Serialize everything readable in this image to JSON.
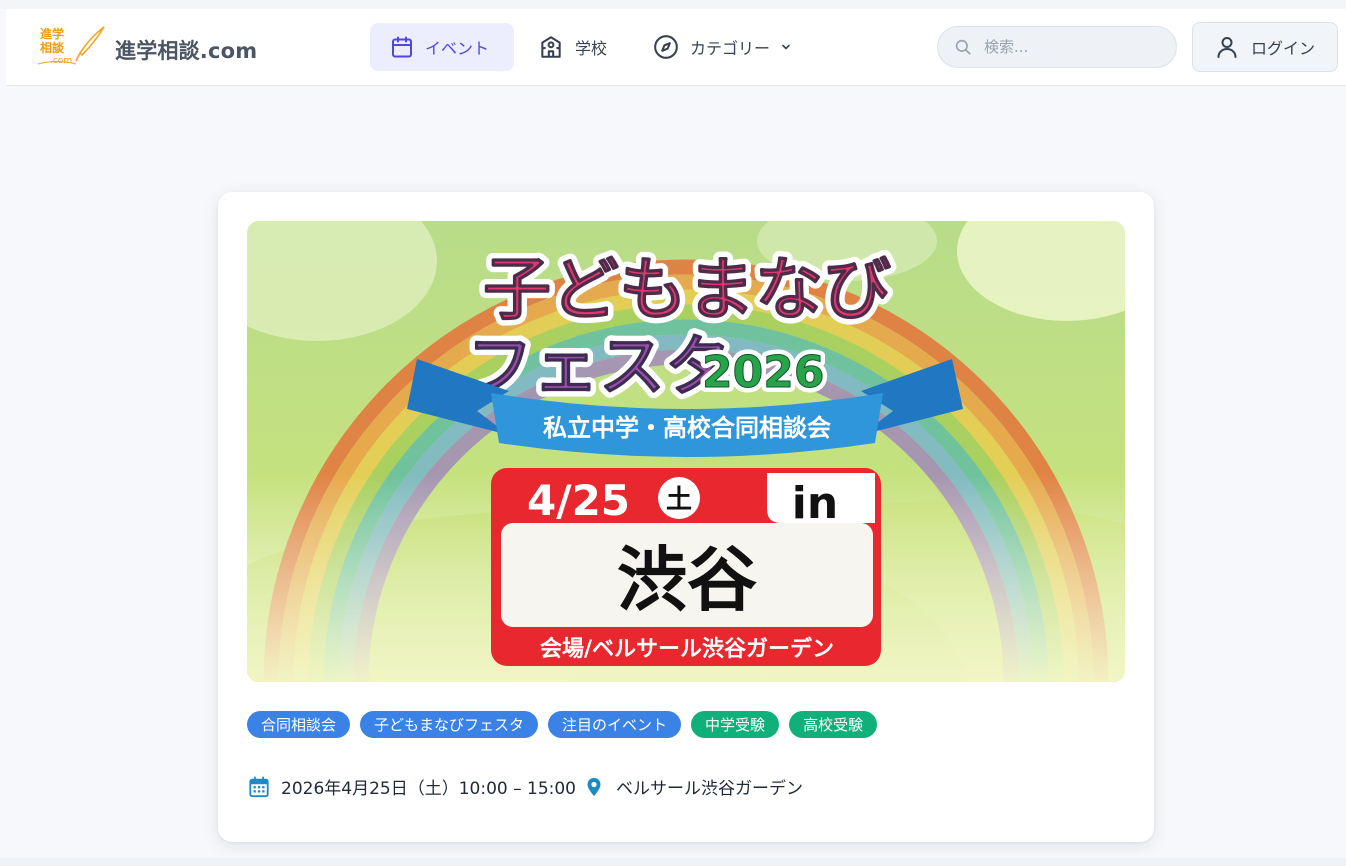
{
  "brand": {
    "site_name": "進学相談.com",
    "logo_line1": "進学",
    "logo_line2": "相談",
    "logo_line3": ".com"
  },
  "nav": {
    "events": "イベント",
    "schools": "学校",
    "categories": "カテゴリー"
  },
  "search": {
    "placeholder": "検索..."
  },
  "login": "ログイン",
  "banner": {
    "title_line1": "子どもまなび",
    "title_line2": "フェスタ",
    "year": "2026",
    "ribbon": "私立中学・高校合同相談会",
    "date": "4/25",
    "weekday": "土",
    "in": "in",
    "place": "渋谷",
    "venue_line": "会場/ベルサール渋谷ガーデン"
  },
  "tags": [
    {
      "label": "合同相談会",
      "color": "#3b82e6"
    },
    {
      "label": "子どもまなびフェスタ",
      "color": "#3b82e6"
    },
    {
      "label": "注目のイベント",
      "color": "#3b82e6"
    },
    {
      "label": "中学受験",
      "color": "#10b07a"
    },
    {
      "label": "高校受験",
      "color": "#10b07a"
    }
  ],
  "event": {
    "datetime": "2026年4月25日（土）10:00 – 15:00",
    "venue": "ベルサール渋谷ガーデン"
  },
  "colors": {
    "accent": "#4f46e5",
    "nav_active_bg": "#eceefd",
    "tag_blue": "#3b82e6",
    "tag_green": "#10b07a"
  },
  "icons": [
    "calendar-icon",
    "school-icon",
    "compass-icon",
    "chevron-down-icon",
    "search-icon",
    "user-icon",
    "calendar-icon",
    "map-pin-icon"
  ]
}
